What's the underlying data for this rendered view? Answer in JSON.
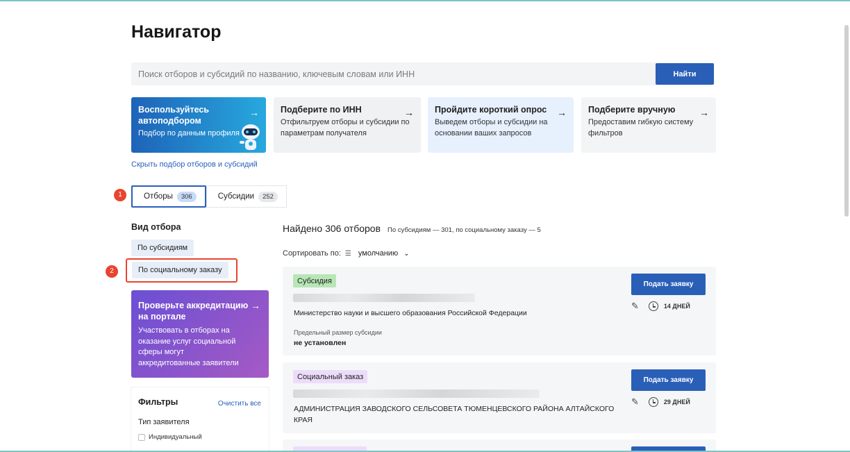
{
  "page": {
    "title": "Навигатор"
  },
  "search": {
    "placeholder": "Поиск отборов и субсидий по названию, ключевым словам или ИНН",
    "button": "Найти"
  },
  "cards": [
    {
      "title": "Воспользуйтесь автоподбором",
      "subtitle": "Подбор по данным профиля"
    },
    {
      "title": "Подберите по ИНН",
      "subtitle": "Отфильтруем отборы и субсидии по параметрам получателя"
    },
    {
      "title": "Пройдите короткий опрос",
      "subtitle": "Выведем отборы и субсидии на основании ваших запросов"
    },
    {
      "title": "Подберите вручную",
      "subtitle": "Предоставим гибкую систему фильтров"
    }
  ],
  "hide_link": "Скрыть подбор отборов и субсидий",
  "tabs": [
    {
      "label": "Отборы",
      "count": "306"
    },
    {
      "label": "Субсидии",
      "count": "252"
    }
  ],
  "markers": [
    "1",
    "2"
  ],
  "sidebar": {
    "heading": "Вид отбора",
    "chips": [
      "По субсидиям",
      "По социальному заказу"
    ],
    "promo": {
      "title": "Проверьте аккредитацию на портале",
      "text": "Участвовать в отборах на оказание услуг социальной сферы могут аккредитованные заявители"
    },
    "filters": {
      "heading": "Фильтры",
      "clear": "Очистить все",
      "group": "Тип заявителя",
      "option": "Индивидуальный"
    }
  },
  "results": {
    "found": "Найдено 306 отборов",
    "breakdown": "По субсидиям — 301, по социальному заказу — 5",
    "sort_label": "Сортировать по:",
    "sort_value": "умолчанию"
  },
  "items": [
    {
      "tag": "Субсидия",
      "org": "Министерство науки и высшего образования Российской Федерации",
      "limit_label": "Предельный размер субсидии",
      "limit_value": "не установлен",
      "button": "Подать заявку",
      "days": "14 ДНЕЙ"
    },
    {
      "tag": "Социальный заказ",
      "org": "АДМИНИСТРАЦИЯ ЗАВОДСКОГО СЕЛЬСОВЕТА ТЮМЕНЦЕВСКОГО РАЙОНА АЛТАЙСКОГО КРАЯ",
      "button": "Подать заявку",
      "days": "29 ДНЕЙ"
    }
  ],
  "colors": {
    "primary": "#2a5fb8",
    "marker": "#e8442f",
    "tag_subsidy": "#b8e6b6",
    "tag_social": "#ecdcfa"
  }
}
